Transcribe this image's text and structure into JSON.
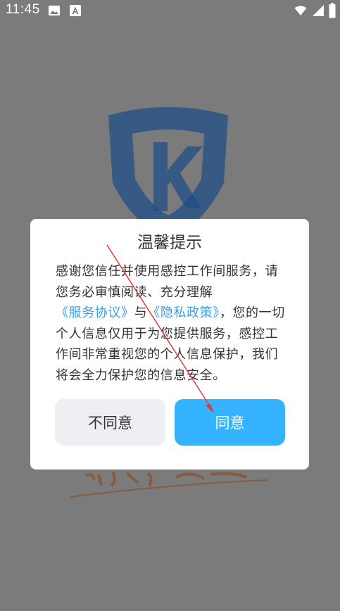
{
  "status_bar": {
    "time": "11:45",
    "icons": [
      "image-icon",
      "a-icon",
      "wifi-icon",
      "signal-icon",
      "battery-icon"
    ]
  },
  "dialog": {
    "title": "温馨提示",
    "body_part1": "感谢您信任并使用感控工作间服务，请您务必审慎阅读、充分理解",
    "link_terms": "《服务协议》",
    "body_and": "与",
    "link_privacy": "《隐私政策》",
    "body_part2": "，您的一切个人信息仅用于为您提供服务，感控工作间非常重视您的个人信息保护，我们将会全力保护您的信息安全。",
    "disagree_label": "不同意",
    "agree_label": "同意"
  },
  "colors": {
    "overlay": "#7b7b7b",
    "link": "#3aa0e6",
    "agree_button": "#36b3ff",
    "disagree_button": "#eeeff2",
    "logo_blue": "#1f4f86"
  }
}
